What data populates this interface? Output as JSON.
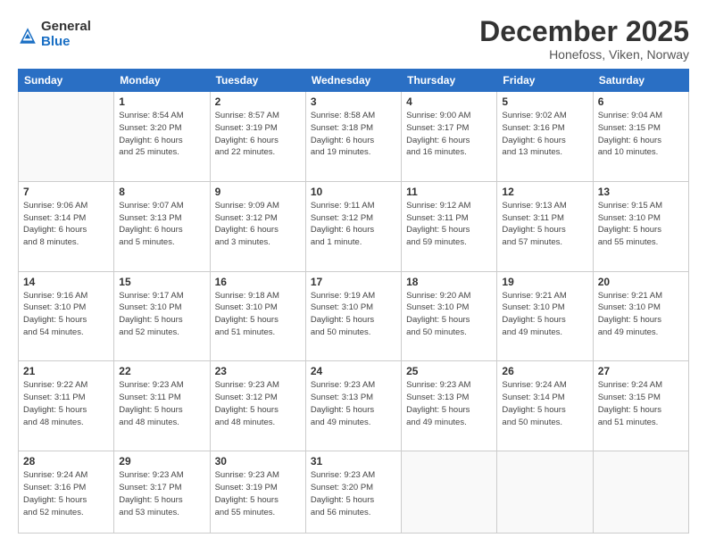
{
  "logo": {
    "general": "General",
    "blue": "Blue"
  },
  "header": {
    "month": "December 2025",
    "location": "Honefoss, Viken, Norway"
  },
  "weekdays": [
    "Sunday",
    "Monday",
    "Tuesday",
    "Wednesday",
    "Thursday",
    "Friday",
    "Saturday"
  ],
  "weeks": [
    [
      {
        "day": "",
        "info": ""
      },
      {
        "day": "1",
        "info": "Sunrise: 8:54 AM\nSunset: 3:20 PM\nDaylight: 6 hours\nand 25 minutes."
      },
      {
        "day": "2",
        "info": "Sunrise: 8:57 AM\nSunset: 3:19 PM\nDaylight: 6 hours\nand 22 minutes."
      },
      {
        "day": "3",
        "info": "Sunrise: 8:58 AM\nSunset: 3:18 PM\nDaylight: 6 hours\nand 19 minutes."
      },
      {
        "day": "4",
        "info": "Sunrise: 9:00 AM\nSunset: 3:17 PM\nDaylight: 6 hours\nand 16 minutes."
      },
      {
        "day": "5",
        "info": "Sunrise: 9:02 AM\nSunset: 3:16 PM\nDaylight: 6 hours\nand 13 minutes."
      },
      {
        "day": "6",
        "info": "Sunrise: 9:04 AM\nSunset: 3:15 PM\nDaylight: 6 hours\nand 10 minutes."
      }
    ],
    [
      {
        "day": "7",
        "info": "Sunrise: 9:06 AM\nSunset: 3:14 PM\nDaylight: 6 hours\nand 8 minutes."
      },
      {
        "day": "8",
        "info": "Sunrise: 9:07 AM\nSunset: 3:13 PM\nDaylight: 6 hours\nand 5 minutes."
      },
      {
        "day": "9",
        "info": "Sunrise: 9:09 AM\nSunset: 3:12 PM\nDaylight: 6 hours\nand 3 minutes."
      },
      {
        "day": "10",
        "info": "Sunrise: 9:11 AM\nSunset: 3:12 PM\nDaylight: 6 hours\nand 1 minute."
      },
      {
        "day": "11",
        "info": "Sunrise: 9:12 AM\nSunset: 3:11 PM\nDaylight: 5 hours\nand 59 minutes."
      },
      {
        "day": "12",
        "info": "Sunrise: 9:13 AM\nSunset: 3:11 PM\nDaylight: 5 hours\nand 57 minutes."
      },
      {
        "day": "13",
        "info": "Sunrise: 9:15 AM\nSunset: 3:10 PM\nDaylight: 5 hours\nand 55 minutes."
      }
    ],
    [
      {
        "day": "14",
        "info": "Sunrise: 9:16 AM\nSunset: 3:10 PM\nDaylight: 5 hours\nand 54 minutes."
      },
      {
        "day": "15",
        "info": "Sunrise: 9:17 AM\nSunset: 3:10 PM\nDaylight: 5 hours\nand 52 minutes."
      },
      {
        "day": "16",
        "info": "Sunrise: 9:18 AM\nSunset: 3:10 PM\nDaylight: 5 hours\nand 51 minutes."
      },
      {
        "day": "17",
        "info": "Sunrise: 9:19 AM\nSunset: 3:10 PM\nDaylight: 5 hours\nand 50 minutes."
      },
      {
        "day": "18",
        "info": "Sunrise: 9:20 AM\nSunset: 3:10 PM\nDaylight: 5 hours\nand 50 minutes."
      },
      {
        "day": "19",
        "info": "Sunrise: 9:21 AM\nSunset: 3:10 PM\nDaylight: 5 hours\nand 49 minutes."
      },
      {
        "day": "20",
        "info": "Sunrise: 9:21 AM\nSunset: 3:10 PM\nDaylight: 5 hours\nand 49 minutes."
      }
    ],
    [
      {
        "day": "21",
        "info": "Sunrise: 9:22 AM\nSunset: 3:11 PM\nDaylight: 5 hours\nand 48 minutes."
      },
      {
        "day": "22",
        "info": "Sunrise: 9:23 AM\nSunset: 3:11 PM\nDaylight: 5 hours\nand 48 minutes."
      },
      {
        "day": "23",
        "info": "Sunrise: 9:23 AM\nSunset: 3:12 PM\nDaylight: 5 hours\nand 48 minutes."
      },
      {
        "day": "24",
        "info": "Sunrise: 9:23 AM\nSunset: 3:13 PM\nDaylight: 5 hours\nand 49 minutes."
      },
      {
        "day": "25",
        "info": "Sunrise: 9:23 AM\nSunset: 3:13 PM\nDaylight: 5 hours\nand 49 minutes."
      },
      {
        "day": "26",
        "info": "Sunrise: 9:24 AM\nSunset: 3:14 PM\nDaylight: 5 hours\nand 50 minutes."
      },
      {
        "day": "27",
        "info": "Sunrise: 9:24 AM\nSunset: 3:15 PM\nDaylight: 5 hours\nand 51 minutes."
      }
    ],
    [
      {
        "day": "28",
        "info": "Sunrise: 9:24 AM\nSunset: 3:16 PM\nDaylight: 5 hours\nand 52 minutes."
      },
      {
        "day": "29",
        "info": "Sunrise: 9:23 AM\nSunset: 3:17 PM\nDaylight: 5 hours\nand 53 minutes."
      },
      {
        "day": "30",
        "info": "Sunrise: 9:23 AM\nSunset: 3:19 PM\nDaylight: 5 hours\nand 55 minutes."
      },
      {
        "day": "31",
        "info": "Sunrise: 9:23 AM\nSunset: 3:20 PM\nDaylight: 5 hours\nand 56 minutes."
      },
      {
        "day": "",
        "info": ""
      },
      {
        "day": "",
        "info": ""
      },
      {
        "day": "",
        "info": ""
      }
    ]
  ]
}
